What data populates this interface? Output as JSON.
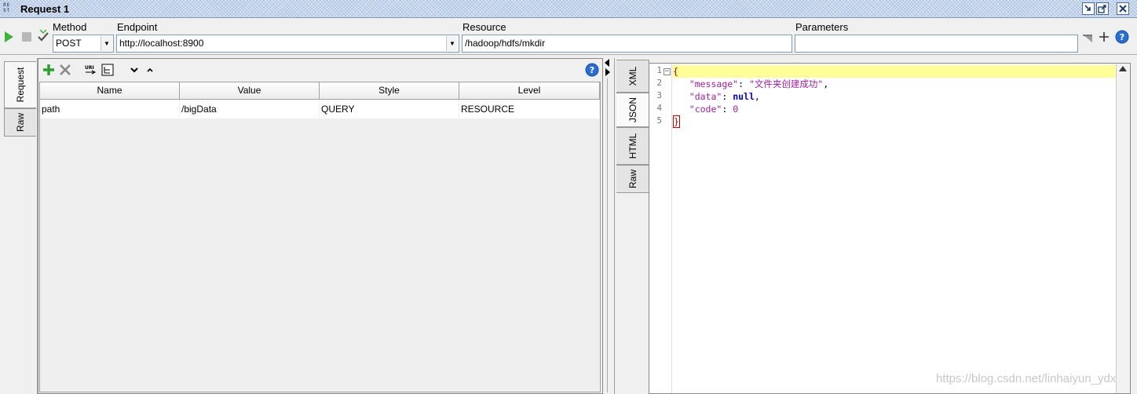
{
  "window": {
    "logo_text": "RE ST",
    "title": "Request 1"
  },
  "toolbar": {
    "method_label": "Method",
    "method_value": "POST",
    "endpoint_label": "Endpoint",
    "endpoint_value": "http://localhost:8900",
    "resource_label": "Resource",
    "resource_value": "/hadoop/hdfs/mkdir",
    "parameters_label": "Parameters",
    "parameters_value": ""
  },
  "request_tabs": [
    {
      "label": "Request",
      "active": true
    },
    {
      "label": "Raw",
      "active": false
    }
  ],
  "params_table": {
    "columns": [
      "Name",
      "Value",
      "Style",
      "Level"
    ],
    "rows": [
      {
        "name": "path",
        "value": "/bigData",
        "style": "QUERY",
        "level": "RESOURCE"
      }
    ]
  },
  "response_tabs": [
    {
      "label": "XML",
      "active": false
    },
    {
      "label": "JSON",
      "active": true
    },
    {
      "label": "HTML",
      "active": false
    },
    {
      "label": "Raw",
      "active": false
    }
  ],
  "response": {
    "line_numbers": [
      "1",
      "2",
      "3",
      "4",
      "5"
    ],
    "json": {
      "open": "{",
      "message_key": "\"message\"",
      "message_value": "\"文件夹创建成功\"",
      "data_key": "\"data\"",
      "data_value": "null",
      "code_key": "\"code\"",
      "code_value": "0",
      "close": "}"
    }
  },
  "watermark": "https://blog.csdn.net/linhaiyun_ydx",
  "colors": {
    "run_green": "#3db33d",
    "add_green": "#2e9e2e",
    "delete_gray": "#888888",
    "help_blue": "#2a6fd0",
    "highlight_line": "#ffff99"
  },
  "icons": [
    "run-icon",
    "stop-icon",
    "validate-icon",
    "add-icon",
    "delete-icon",
    "uri-icon",
    "tree-icon",
    "move-down-icon",
    "move-up-icon",
    "help-icon",
    "clear-icon",
    "plus-icon"
  ]
}
